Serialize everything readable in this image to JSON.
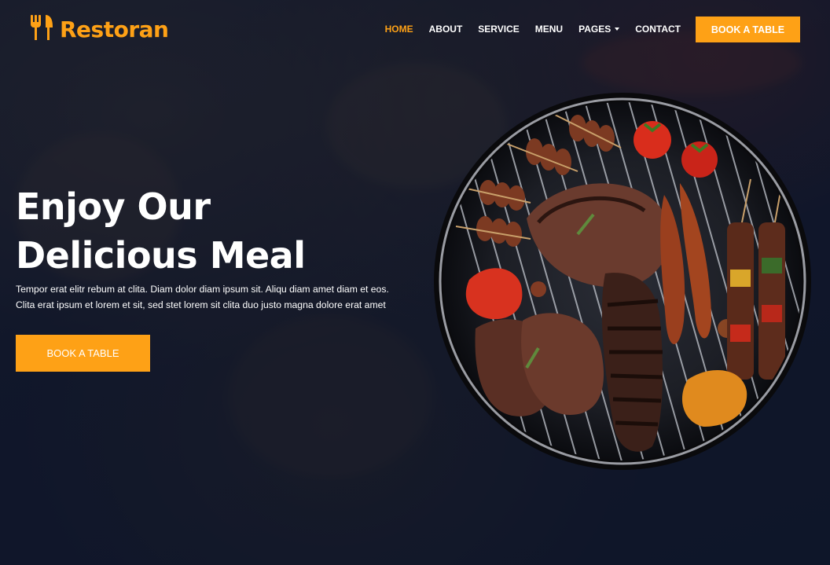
{
  "brand": {
    "name": "Restoran",
    "icon": "utensils-icon",
    "accent": "#fea116"
  },
  "nav": {
    "items": [
      {
        "label": "HOME",
        "active": true
      },
      {
        "label": "ABOUT",
        "active": false
      },
      {
        "label": "SERVICE",
        "active": false
      },
      {
        "label": "MENU",
        "active": false
      },
      {
        "label": "PAGES",
        "active": false,
        "dropdown": true
      },
      {
        "label": "CONTACT",
        "active": false
      }
    ],
    "cta_label": "BOOK A TABLE"
  },
  "hero": {
    "headline_line1": "Enjoy Our",
    "headline_line2": "Delicious Meal",
    "lead": "Tempor erat elitr rebum at clita. Diam dolor diam ipsum sit. Aliqu diam amet diam et eos. Clita erat ipsum et lorem et sit, sed stet lorem sit clita duo justo magna dolore erat amet",
    "cta_label": "BOOK A TABLE",
    "image": "bbq-grill-image"
  },
  "colors": {
    "primary": "#fea116",
    "dark": "#0f172b",
    "text": "#ffffff"
  }
}
